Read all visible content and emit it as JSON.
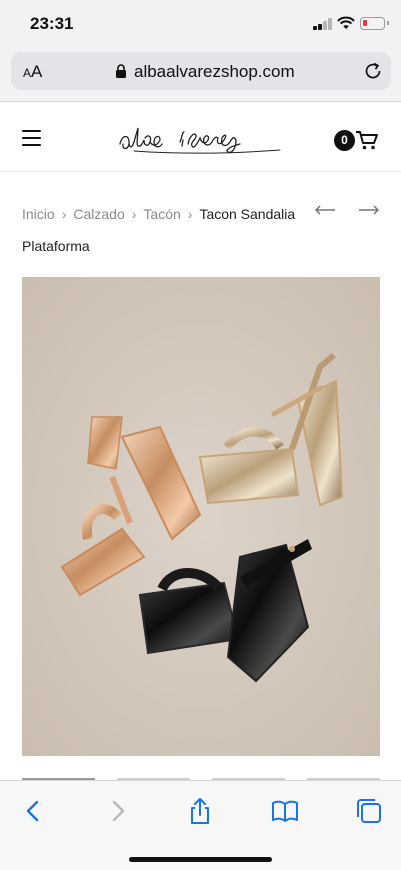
{
  "status_bar": {
    "time": "23:31",
    "battery_color": "#e53935"
  },
  "browser": {
    "text_size_label": "AA",
    "url": "albaalvarezshop.com",
    "icons": [
      "lock-icon",
      "reload-icon"
    ]
  },
  "site": {
    "logo_text": "alba alvarez",
    "cart_count": "0",
    "icons": [
      "menu-icon",
      "cart-icon"
    ]
  },
  "breadcrumb": {
    "items": [
      "Inicio",
      "Calzado",
      "Tacón"
    ],
    "separator": "›",
    "current": "Tacon Sandalia Plataforma"
  },
  "product": {
    "image_alt": "Sandalias de tacón con plataforma en dorado, rosa dorado y negro charol",
    "thumbnail_count": 4
  },
  "toolbar": {
    "icons": [
      "back-icon",
      "forward-icon",
      "share-icon",
      "bookmarks-icon",
      "tabs-icon"
    ],
    "accent": "#1a73e8"
  }
}
